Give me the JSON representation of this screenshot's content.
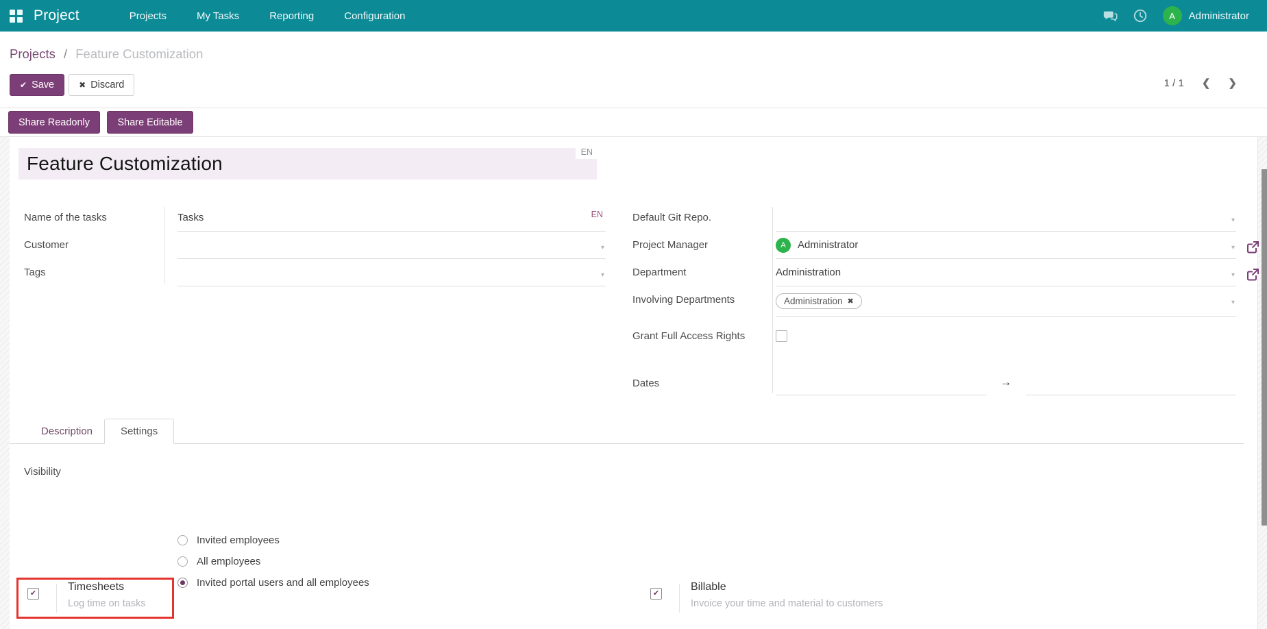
{
  "colors": {
    "topbar": "#0c8b96",
    "accent_purple": "#7c3e76",
    "link_purple": "#714b67",
    "title_highlight": "#f3ecf4",
    "avatar_green": "#2cb34b",
    "highlight_red": "#e5342e"
  },
  "glyphs": {
    "check": "✔",
    "cross": "✖",
    "caret": "▾",
    "arrow_right": "→",
    "chevron_left": "❮",
    "chevron_right": "❯",
    "tag_remove": "✖"
  },
  "topbar": {
    "app_name": "Project",
    "menu_items": [
      "Projects",
      "My Tasks",
      "Reporting",
      "Configuration"
    ],
    "user_name": "Administrator",
    "avatar_initial": "A"
  },
  "breadcrumb": {
    "parent": "Projects",
    "separator": "/",
    "current": "Feature Customization"
  },
  "control_panel": {
    "save_label": "Save",
    "discard_label": "Discard",
    "pager": "1 / 1"
  },
  "statusbar": {
    "share_readonly_label": "Share Readonly",
    "share_editable_label": "Share Editable"
  },
  "form": {
    "title": "Feature Customization",
    "title_lang": "EN",
    "left": {
      "name_label": "Name of the tasks",
      "name_value": "Tasks",
      "name_lang": "EN",
      "customer_label": "Customer",
      "customer_value": "",
      "tags_label": "Tags",
      "tags_value": ""
    },
    "right": {
      "git_label": "Default Git Repo.",
      "git_value": "",
      "manager_label": "Project Manager",
      "manager_value": "Administrator",
      "manager_avatar_initial": "A",
      "department_label": "Department",
      "department_value": "Administration",
      "involving_label": "Involving Departments",
      "involving_tag": "Administration",
      "grant_label": "Grant Full Access Rights",
      "dates_label": "Dates",
      "date_start": "",
      "date_end": ""
    }
  },
  "tabs": {
    "description": "Description",
    "settings": "Settings"
  },
  "settings": {
    "visibility_label": "Visibility",
    "visibility_options": [
      "Invited employees",
      "All employees",
      "Invited portal users and all employees"
    ],
    "visibility_selected": "Invited portal users and all employees",
    "features": [
      {
        "name": "Timesheets",
        "description": "Log time on tasks"
      },
      {
        "name": "Billable",
        "description": "Invoice your time and material to customers"
      }
    ]
  }
}
